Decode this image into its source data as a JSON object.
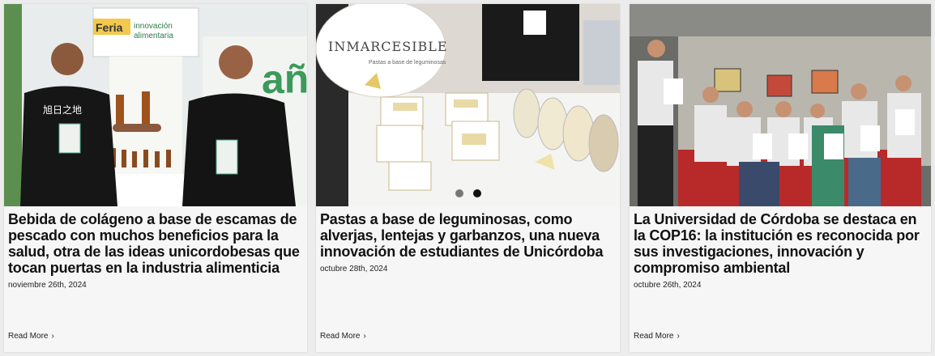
{
  "cards": [
    {
      "title": "Bebida de colágeno a base de escamas de pescado con muchos beneficios para la salud, otra de las ideas unicordobesas que tocan puertas en la industria alimenticia",
      "date": "noviembre 26th, 2024",
      "read_more": "Read More",
      "image_signs": [
        "Feria",
        "innovación",
        "alimentaria"
      ],
      "shirt_text": "旭日之地"
    },
    {
      "title": "Pastas a base de leguminosas, como alverjas, lentejas y garbanzos, una nueva innovación de estudiantes de Unicórdoba",
      "date": "octubre 28th, 2024",
      "read_more": "Read More",
      "image_signs": [
        "INMARCESIBLE",
        "Pastas a base de leguminosas"
      ]
    },
    {
      "title": "La Universidad de Córdoba se destaca en la COP16: la institución es reconocida por sus investigaciones, innovación y compromiso ambiental",
      "date": "octubre 26th, 2024",
      "read_more": "Read More"
    }
  ],
  "carousel": {
    "slides": 2,
    "active_index": 1
  },
  "colors": {
    "card_bg": "#f6f6f6",
    "page_bg": "#ececec",
    "title": "#111111"
  },
  "icons": {
    "read_more": "chevron-right-icon"
  }
}
